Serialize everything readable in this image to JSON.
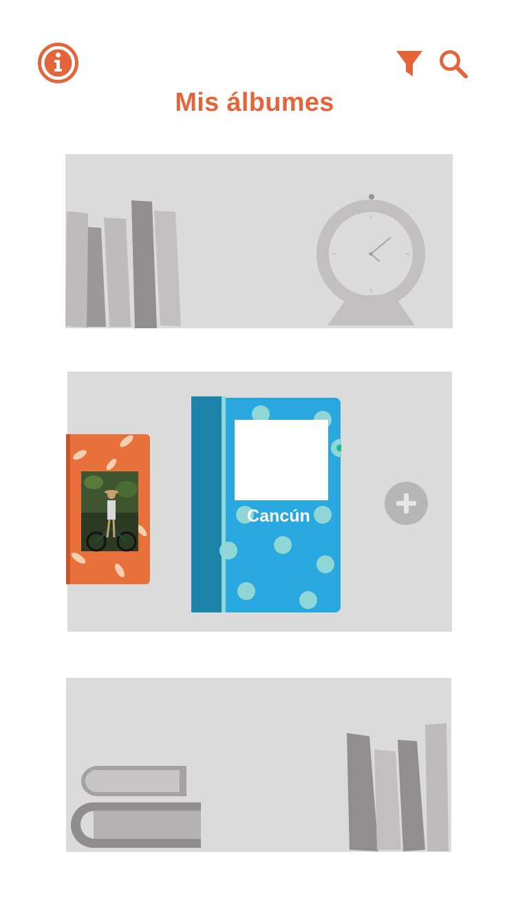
{
  "header": {
    "title": "Mis álbumes",
    "info_icon": "info-icon",
    "filter_icon": "filter-icon",
    "search_icon": "search-icon"
  },
  "albums": [
    {
      "title": "",
      "cover_color": "#e8703a",
      "cover_style": "palm-leaves with photo"
    },
    {
      "title": "Cancún",
      "cover_color": "#29a8e0",
      "cover_style": "polka-dots"
    }
  ],
  "add_album_icon": "plus-icon",
  "colors": {
    "accent": "#e4653a",
    "shelf": "#dcdbdc",
    "book_blue": "#29a8e0",
    "book_orange": "#e8703a"
  }
}
